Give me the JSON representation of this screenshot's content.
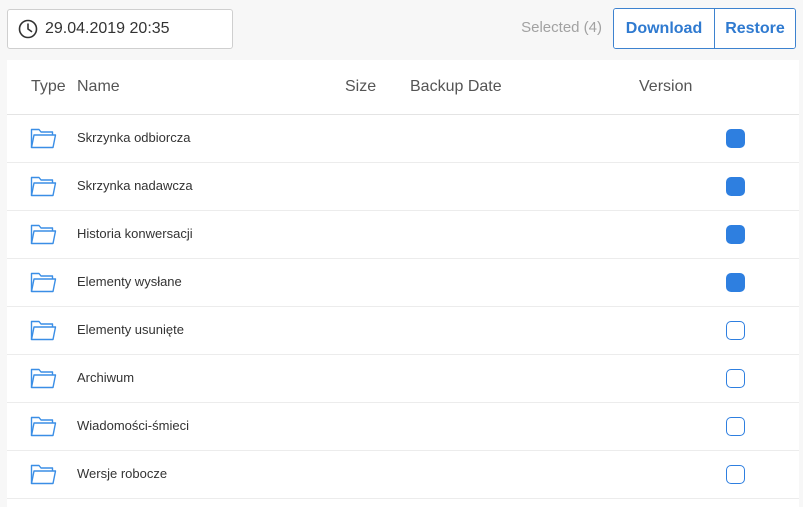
{
  "toolbar": {
    "date": "29.04.2019 20:35",
    "selected_label": "Selected (4)",
    "download_label": "Download",
    "restore_label": "Restore"
  },
  "table": {
    "columns": {
      "type": "Type",
      "name": "Name",
      "size": "Size",
      "backup_date": "Backup Date",
      "version": "Version"
    },
    "rows": [
      {
        "name": "Skrzynka odbiorcza",
        "checked": true
      },
      {
        "name": "Skrzynka nadawcza",
        "checked": true
      },
      {
        "name": "Historia konwersacji",
        "checked": true
      },
      {
        "name": "Elementy wysłane",
        "checked": true
      },
      {
        "name": "Elementy usunięte",
        "checked": false
      },
      {
        "name": "Archiwum",
        "checked": false
      },
      {
        "name": "Wiadomości-śmieci",
        "checked": false
      },
      {
        "name": "Wersje robocze",
        "checked": false
      }
    ]
  },
  "colors": {
    "accent": "#2e7fe0",
    "folder_icon": "#3a8ee6"
  },
  "icons": {
    "date": "clock-icon",
    "row": "folder-icon"
  }
}
